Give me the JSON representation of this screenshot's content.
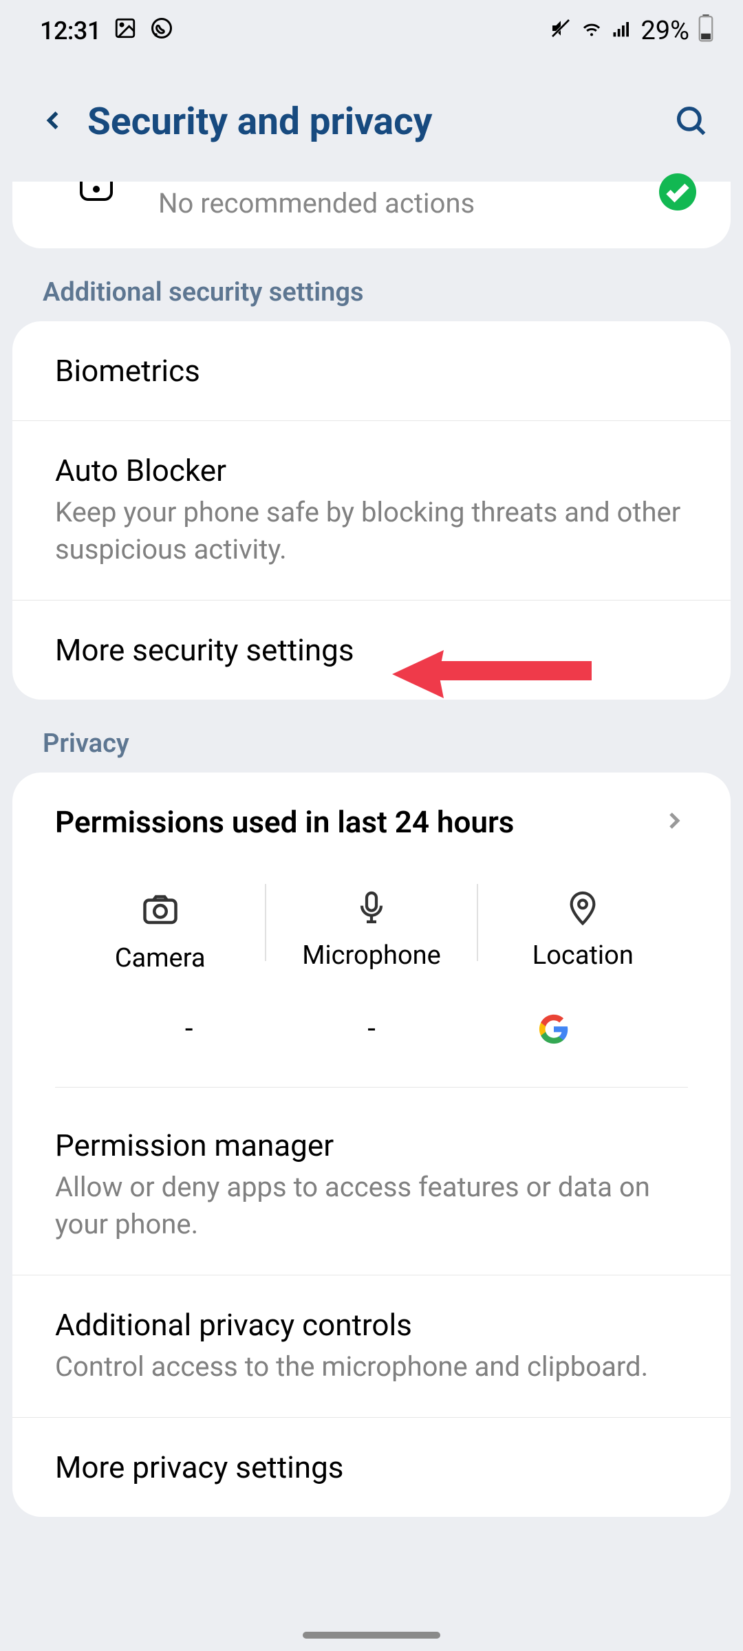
{
  "statusBar": {
    "time": "12:31",
    "battery": "29%"
  },
  "header": {
    "title": "Security and privacy"
  },
  "peek": {
    "subtitle": "No recommended actions"
  },
  "sections": {
    "additional": {
      "title": "Additional security settings",
      "items": {
        "biometrics": {
          "title": "Biometrics"
        },
        "autoBlocker": {
          "title": "Auto Blocker",
          "sub": "Keep your phone safe by blocking threats and other suspicious activity."
        },
        "moreSecurity": {
          "title": "More security settings"
        }
      }
    },
    "privacy": {
      "title": "Privacy",
      "permUsed": {
        "title": "Permissions used in last 24 hours"
      },
      "permGrid": {
        "camera": "Camera",
        "microphone": "Microphone",
        "location": "Location",
        "dash": "-"
      },
      "permManager": {
        "title": "Permission manager",
        "sub": "Allow or deny apps to access features or data on your phone."
      },
      "additionalPrivacy": {
        "title": "Additional privacy controls",
        "sub": "Control access to the microphone and clipboard."
      },
      "morePrivacy": {
        "title": "More privacy settings"
      }
    }
  }
}
